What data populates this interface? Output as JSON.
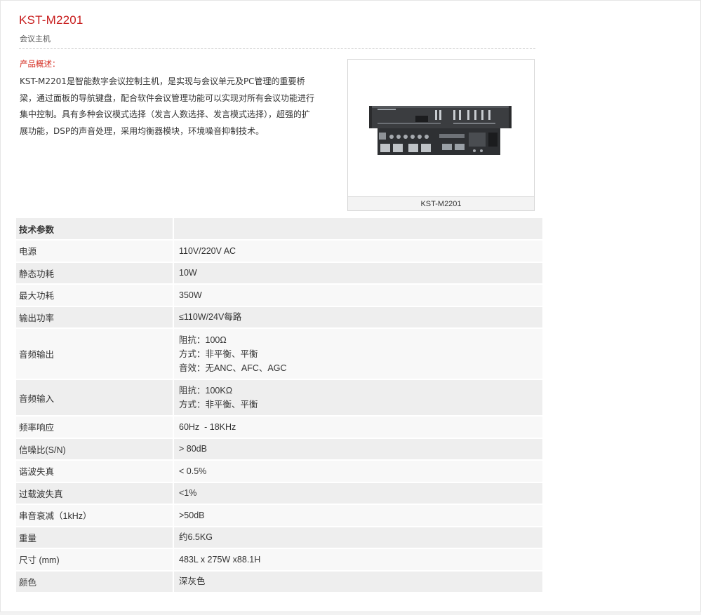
{
  "product": {
    "title": "KST-M2201",
    "subtitle": "会议主机",
    "overview_heading": "产品概述：",
    "overview_text": "KST-M2201是智能数字会议控制主机，是实现与会议单元及PC管理的重要桥梁，通过面板的导航键盘，配合软件会议管理功能可以实现对所有会议功能进行集中控制。具有多种会议模式选择（发言人数选择、发言模式选择），超强的扩展功能，DSP的声音处理，采用均衡器模块，环境噪音抑制技术。",
    "image_caption": "KST-M2201",
    "image_icon": "conference-host-device-photo"
  },
  "specs": {
    "header": "技术参数",
    "header_value": "",
    "rows": [
      {
        "label": "电源",
        "value": "110V/220V AC"
      },
      {
        "label": "静态功耗",
        "value": "10W"
      },
      {
        "label": "最大功耗",
        "value": "350W"
      },
      {
        "label": "输出功率",
        "value": "≤110W/24V每路"
      },
      {
        "label": "音频输出",
        "lines": [
          "阻抗：100Ω",
          "方式：非平衡、平衡",
          "音效：无ANC、AFC、AGC"
        ]
      },
      {
        "label": "音频输入",
        "lines": [
          "阻抗：100KΩ",
          "方式：非平衡、平衡"
        ]
      },
      {
        "label": "频率响应",
        "value": "60Hz  - 18KHz"
      },
      {
        "label": "信噪比(S/N)",
        "value": "> 80dB"
      },
      {
        "label": "谐波失真",
        "value": "< 0.5%"
      },
      {
        "label": "过载波失真",
        "value": "<1%"
      },
      {
        "label": "串音衰减（1kHz）",
        "value": ">50dB"
      },
      {
        "label": "重量",
        "value": "约6.5KG"
      },
      {
        "label": "尺寸 (mm)",
        "value": "483L x 275W x88.1H"
      },
      {
        "label": "颜色",
        "value": "深灰色"
      }
    ]
  },
  "colors": {
    "title_red": "#c81e1e",
    "row_dark": "#eeeeee",
    "row_light": "#f8f8f8"
  }
}
